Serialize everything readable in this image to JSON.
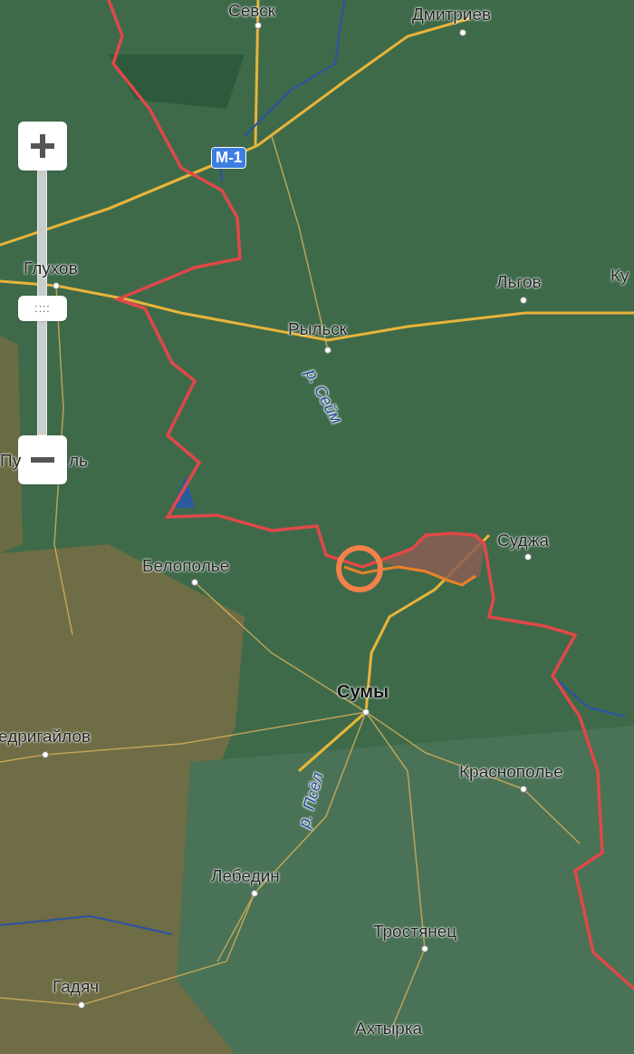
{
  "zoom_control": {
    "thumb_label": "::::",
    "level": 0.48
  },
  "route_badge": {
    "text": "М-1"
  },
  "labels": [
    {
      "text": "Севск",
      "kind": "town"
    },
    {
      "text": "Дмитриев",
      "kind": "town"
    },
    {
      "text": "Глухов",
      "kind": "town"
    },
    {
      "text": "Льгов",
      "kind": "town"
    },
    {
      "text": "Ку",
      "kind": "town"
    },
    {
      "text": "Рыльск",
      "kind": "town"
    },
    {
      "text": "р. Сейм",
      "kind": "river"
    },
    {
      "text": "Пу",
      "kind": "town"
    },
    {
      "text": "ль",
      "kind": "town"
    },
    {
      "text": "Суджа",
      "kind": "town"
    },
    {
      "text": "Белополье",
      "kind": "town"
    },
    {
      "text": "Сумы",
      "kind": "capital"
    },
    {
      "text": "едригайлов",
      "kind": "town"
    },
    {
      "text": "Краснополье",
      "kind": "town"
    },
    {
      "text": "р. Псёл",
      "kind": "river"
    },
    {
      "text": "Лебедин",
      "kind": "town"
    },
    {
      "text": "Тростянец",
      "kind": "town"
    },
    {
      "text": "Гадяч",
      "kind": "town"
    },
    {
      "text": "Ахтырка",
      "kind": "town"
    }
  ]
}
